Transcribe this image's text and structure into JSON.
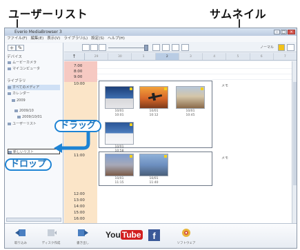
{
  "callouts": {
    "user_list": "ユーザーリスト",
    "thumbnail": "サムネイル",
    "drag": "ドラッグ",
    "drop": "ドロップ"
  },
  "window": {
    "title": "Everio MediaBrowser 3",
    "menu": [
      "ファイル(F)",
      "編集(E)",
      "表示(V)",
      "ライブラリ(L)",
      "設定(S)",
      "ヘルプ(H)"
    ]
  },
  "sidebar": {
    "device_heading": "デバイス",
    "devices": [
      "ムービーカメラ",
      "マイコンピュータ"
    ],
    "library_heading": "ライブラリ",
    "library_items": [
      "すべてのメディア",
      "カレンダー",
      "2009",
      "2009/10",
      "2009/10/01",
      "ユーザーリスト"
    ],
    "new_list_label": "新しいリスト"
  },
  "main": {
    "mode_label": "ノーマル",
    "up_glyph": "↑",
    "days": [
      "29",
      "30",
      "1",
      "2",
      "3",
      "4",
      "5",
      "6",
      "7"
    ],
    "active_day_index": 3,
    "times": [
      "7:00",
      "8:00",
      "9:00",
      "10:00",
      "11:00",
      "12:00",
      "13:00",
      "14:00",
      "15:00",
      "16:00"
    ],
    "group1_note": "メモ",
    "group2_note": "メモ",
    "thumbs": [
      {
        "date": "10/01",
        "time": "10:01"
      },
      {
        "date": "10/01",
        "time": "10:12"
      },
      {
        "date": "10/01",
        "time": "10:45"
      },
      {
        "date": "10/01",
        "time": "10:58"
      },
      {
        "date": "10/01",
        "time": "11:15"
      },
      {
        "date": "10/01",
        "time": "11:40"
      }
    ]
  },
  "bottom_bar": {
    "items": [
      "取り込み",
      "ディスク作成",
      "書き出し"
    ],
    "youtube": {
      "you": "You",
      "tube": "Tube"
    },
    "facebook": "f",
    "extra": "ソフトウェア"
  }
}
